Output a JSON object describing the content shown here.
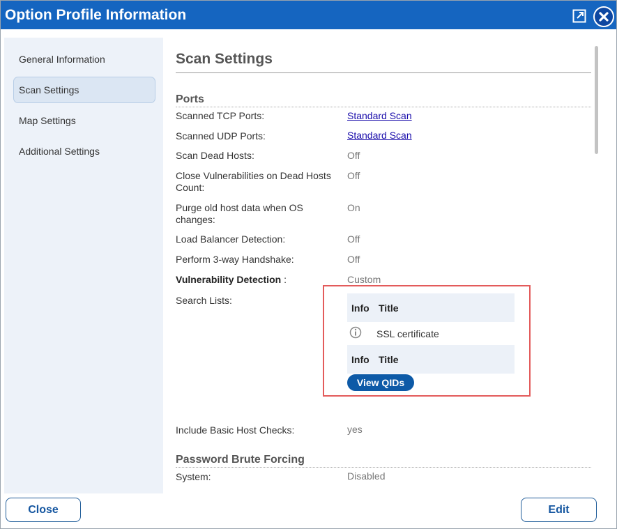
{
  "window": {
    "title": "Option Profile Information"
  },
  "sidebar": {
    "items": [
      {
        "label": "General Information",
        "active": false
      },
      {
        "label": "Scan Settings",
        "active": true
      },
      {
        "label": "Map Settings",
        "active": false
      },
      {
        "label": "Additional Settings",
        "active": false
      }
    ]
  },
  "content": {
    "heading": "Scan Settings",
    "ports": {
      "heading": "Ports",
      "rows": [
        {
          "label": "Scanned TCP Ports:",
          "value": "Standard Scan"
        },
        {
          "label": "Scanned UDP Ports:",
          "value": "Standard Scan"
        },
        {
          "label": "Scan Dead Hosts:",
          "value": "Off"
        },
        {
          "label": "Close Vulnerabilities on Dead Hosts Count:",
          "value": "Off"
        },
        {
          "label": "Purge old host data when OS changes:",
          "value": "On"
        },
        {
          "label": "Load Balancer Detection:",
          "value": "Off"
        },
        {
          "label": "Perform 3-way Handshake:",
          "value": "Off"
        }
      ]
    },
    "vulnerability_detection": {
      "label": "Vulnerability Detection",
      "suffix": " :",
      "value": "Custom"
    },
    "search_lists": {
      "label": "Search Lists:",
      "header_info": "Info",
      "header_title": "Title",
      "item_title": "SSL certificate",
      "view_qids": "View QIDs"
    },
    "basic_host_checks": {
      "label": "Include Basic Host Checks:",
      "value": "yes"
    },
    "password_brute_forcing": {
      "heading": "Password Brute Forcing",
      "system_label": "System:",
      "system_value": "Disabled"
    }
  },
  "footer": {
    "close_label": "Close",
    "edit_label": "Edit"
  },
  "colors": {
    "titlebar": "#1565c0",
    "sidebar": "#edf2f9",
    "highlight": "#e35b5b",
    "button_text": "#1556a0"
  },
  "icons": [
    "popout-icon",
    "close-icon",
    "info-icon"
  ]
}
